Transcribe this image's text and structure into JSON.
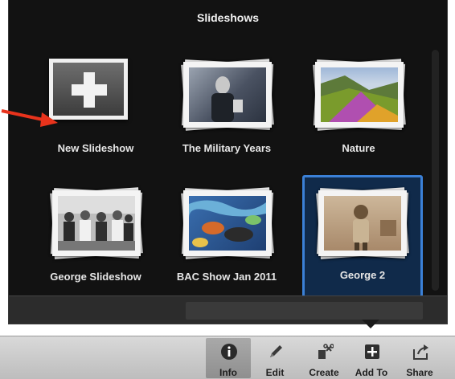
{
  "popover": {
    "title": "Slideshows",
    "tiles": [
      {
        "label": "New Slideshow",
        "icon": "plus-icon"
      },
      {
        "label": "The Military Years"
      },
      {
        "label": "Nature"
      },
      {
        "label": "George Slideshow"
      },
      {
        "label": "BAC Show Jan 2011"
      },
      {
        "label": "George 2",
        "selected": true
      }
    ]
  },
  "toolbar": {
    "items": [
      {
        "label": "Info",
        "icon": "info-icon",
        "active": true
      },
      {
        "label": "Edit",
        "icon": "pencil-icon"
      },
      {
        "label": "Create",
        "icon": "create-icon"
      },
      {
        "label": "Add To",
        "icon": "add-icon"
      },
      {
        "label": "Share",
        "icon": "share-icon"
      }
    ]
  },
  "colors": {
    "selection": "#3b80d6",
    "annotation_arrow": "#e8331c"
  }
}
